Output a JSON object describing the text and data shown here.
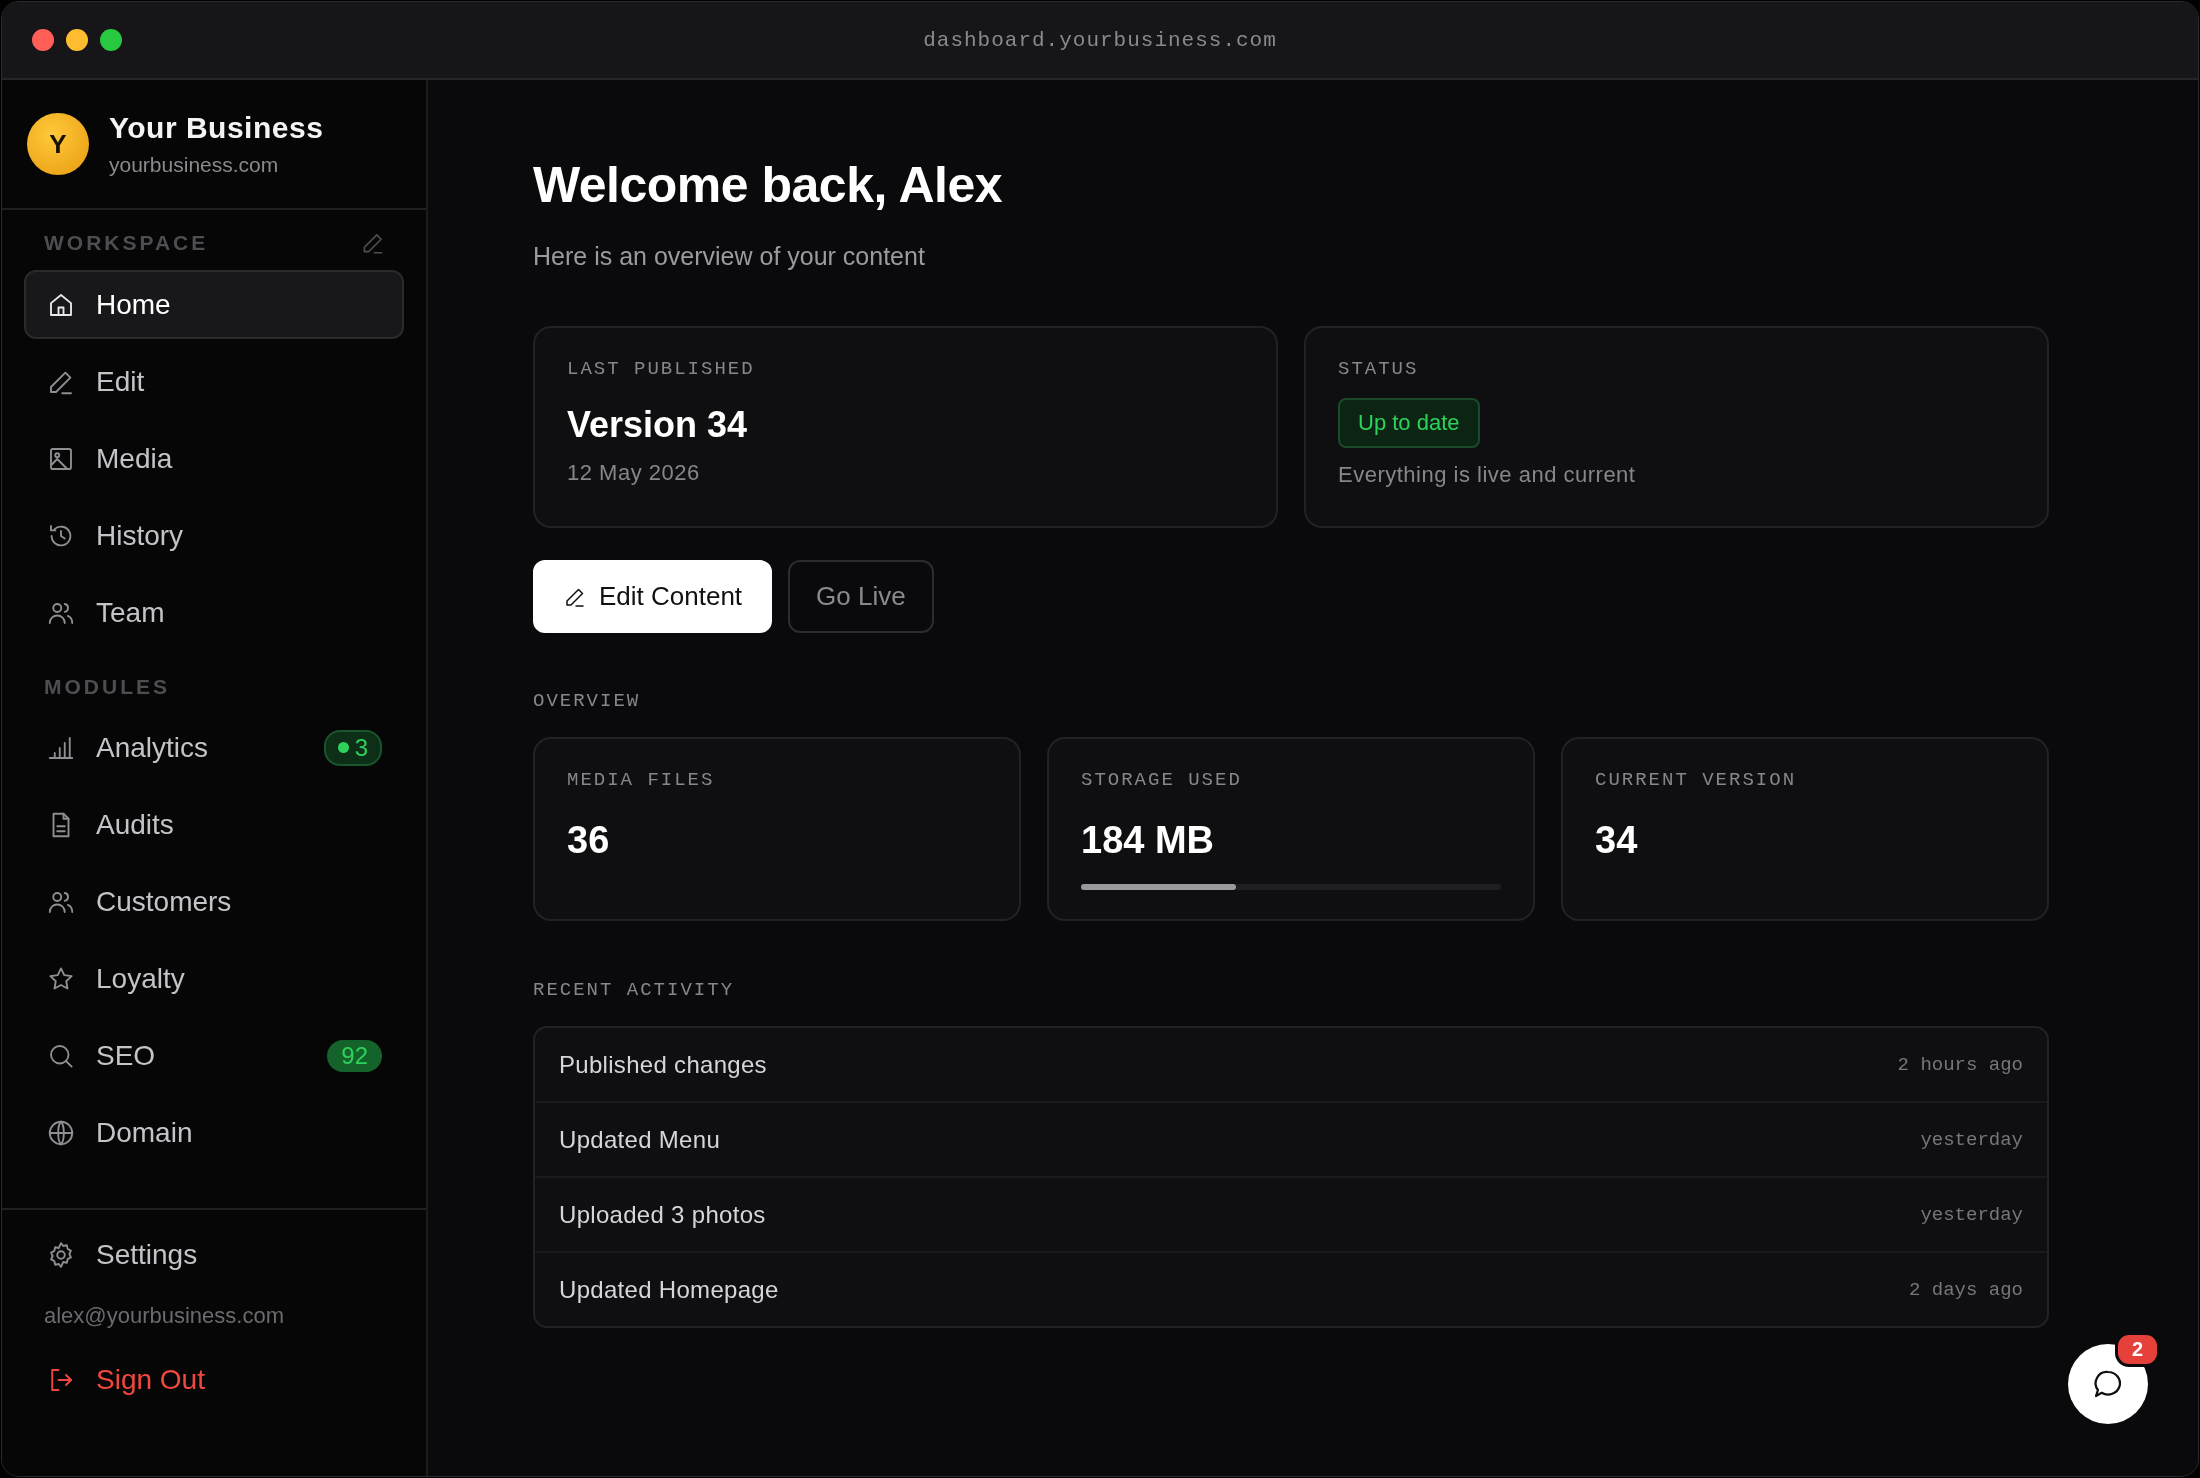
{
  "window": {
    "url": "dashboard.yourbusiness.com"
  },
  "sidebar": {
    "brand": {
      "initial": "Y",
      "name": "Your Business",
      "domain": "yourbusiness.com"
    },
    "sections": [
      {
        "label": "WORKSPACE",
        "editable": true,
        "items": [
          {
            "label": "Home",
            "selected": true
          },
          {
            "label": "Edit",
            "selected": false
          },
          {
            "label": "Media",
            "selected": false
          },
          {
            "label": "History",
            "selected": false
          },
          {
            "label": "Team",
            "selected": false
          }
        ]
      },
      {
        "label": "MODULES",
        "editable": false,
        "items": [
          {
            "label": "Analytics",
            "selected": false,
            "badge": {
              "text": "3",
              "dot": true
            }
          },
          {
            "label": "Audits",
            "selected": false
          },
          {
            "label": "Customers",
            "selected": false
          },
          {
            "label": "Loyalty",
            "selected": false
          },
          {
            "label": "SEO",
            "selected": false,
            "badge": {
              "text": "92",
              "dot": false
            }
          },
          {
            "label": "Domain",
            "selected": false
          }
        ]
      }
    ],
    "settings": "Settings",
    "email": "alex@yourbusiness.com",
    "sign_out": "Sign Out"
  },
  "main": {
    "title": "Welcome back, Alex",
    "subtitle": "Here is an overview of your content",
    "last_published": {
      "label": "LAST PUBLISHED",
      "value": "Version 34",
      "date": "12 May 2026"
    },
    "status": {
      "label": "STATUS",
      "badge": "Up to date",
      "text": "Everything is live and current"
    },
    "buttons": [
      {
        "label": "Edit Content",
        "kind": "primary"
      },
      {
        "label": "Go Live",
        "kind": "secondary"
      }
    ],
    "overview_label": "OVERVIEW",
    "stats": [
      {
        "label": "MEDIA FILES",
        "value": "36"
      },
      {
        "label": "STORAGE USED",
        "value": "184 MB",
        "level": 0.37
      },
      {
        "label": "CURRENT VERSION",
        "value": "34"
      }
    ],
    "activity_label": "RECENT ACTIVITY",
    "activity": [
      {
        "text": "Published changes",
        "time": "2 hours ago"
      },
      {
        "text": "Updated Menu",
        "time": "yesterday"
      },
      {
        "text": "Uploaded 3 photos",
        "time": "yesterday"
      },
      {
        "text": "Updated Homepage",
        "time": "2 days ago"
      }
    ]
  },
  "chat": {
    "badge": "2"
  }
}
